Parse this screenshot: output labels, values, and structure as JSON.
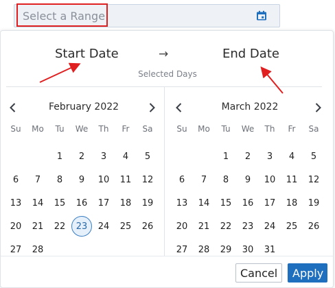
{
  "range_input": {
    "placeholder": "Select a Range"
  },
  "header": {
    "start_label": "Start Date",
    "arrow": "→",
    "end_label": "End Date",
    "selected_days": "Selected Days"
  },
  "weekdays": [
    "Su",
    "Mo",
    "Tu",
    "We",
    "Th",
    "Fr",
    "Sa"
  ],
  "calendars": [
    {
      "title": "February 2022",
      "weeks": [
        [
          "",
          "",
          "1",
          "2",
          "3",
          "4",
          "5"
        ],
        [
          "6",
          "7",
          "8",
          "9",
          "10",
          "11",
          "12"
        ],
        [
          "13",
          "14",
          "15",
          "16",
          "17",
          "18",
          "19"
        ],
        [
          "20",
          "21",
          "22",
          "23",
          "24",
          "25",
          "26"
        ],
        [
          "27",
          "28",
          "",
          "",
          "",
          "",
          ""
        ]
      ],
      "today": "23"
    },
    {
      "title": "March 2022",
      "weeks": [
        [
          "",
          "",
          "1",
          "2",
          "3",
          "4",
          "5"
        ],
        [
          "6",
          "7",
          "8",
          "9",
          "10",
          "11",
          "12"
        ],
        [
          "13",
          "14",
          "15",
          "16",
          "17",
          "18",
          "19"
        ],
        [
          "20",
          "21",
          "22",
          "23",
          "24",
          "25",
          "26"
        ],
        [
          "27",
          "28",
          "29",
          "30",
          "31",
          "",
          ""
        ]
      ],
      "today": ""
    }
  ],
  "buttons": {
    "cancel": "Cancel",
    "apply": "Apply"
  },
  "colors": {
    "accent": "#1f6fbf",
    "annotation": "#e02020",
    "today_border": "#3b7fc4"
  },
  "icons": {
    "input": "calendar-icon",
    "prev": "chevron-left-icon",
    "next": "chevron-right-icon"
  }
}
